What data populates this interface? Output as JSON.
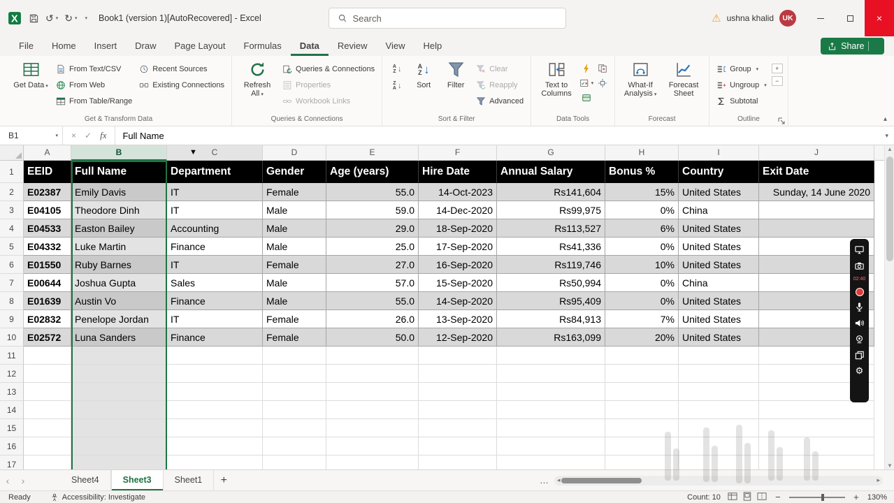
{
  "colors": {
    "accent_green": "#217346",
    "excel_logo_green": "#107c41",
    "header_fill": "#000000",
    "band_gray": "#d9d9d9",
    "close_red": "#e81123",
    "record_red": "#e03a3a",
    "avatar_red": "#bb3a42",
    "warning_yellow": "#e8a33d"
  },
  "title_bar": {
    "title": "Book1 (version 1)[AutoRecovered] -  Excel",
    "search_placeholder": "Search",
    "user_name": "ushna khalid",
    "user_initials": "UK"
  },
  "ribbon_tabs": [
    "File",
    "Home",
    "Insert",
    "Draw",
    "Page Layout",
    "Formulas",
    "Data",
    "Review",
    "View",
    "Help"
  ],
  "active_tab": "Data",
  "share_label": "Share",
  "ribbon": {
    "get_transform": {
      "label": "Get & Transform Data",
      "get_data": "Get Data",
      "from_text_csv": "From Text/CSV",
      "from_web": "From Web",
      "from_table_range": "From Table/Range",
      "recent_sources": "Recent Sources",
      "existing_connections": "Existing Connections"
    },
    "queries": {
      "label": "Queries & Connections",
      "refresh_all": "Refresh All",
      "queries_connections": "Queries & Connections",
      "properties": "Properties",
      "workbook_links": "Workbook Links"
    },
    "sort_filter": {
      "label": "Sort & Filter",
      "sort": "Sort",
      "filter": "Filter",
      "clear": "Clear",
      "reapply": "Reapply",
      "advanced": "Advanced"
    },
    "data_tools": {
      "label": "Data Tools",
      "text_to_columns": "Text to Columns"
    },
    "forecast": {
      "label": "Forecast",
      "what_if": "What-If Analysis",
      "forecast_sheet": "Forecast Sheet"
    },
    "outline": {
      "label": "Outline",
      "group": "Group",
      "ungroup": "Ungroup",
      "subtotal": "Subtotal"
    }
  },
  "formula_bar": {
    "name_box": "B1",
    "value": "Full Name"
  },
  "grid": {
    "columns": [
      "A",
      "B",
      "C",
      "D",
      "E",
      "F",
      "G",
      "H",
      "I",
      "J"
    ],
    "selected_column": "B",
    "cursor_column": "C",
    "visible_rows": 17,
    "headers": [
      "EEID",
      "Full Name",
      "Department",
      "Gender",
      "Age (years)",
      "Hire Date",
      "Annual Salary",
      "Bonus %",
      "Country",
      "Exit Date"
    ],
    "data": [
      [
        "E02387",
        "Emily Davis",
        "IT",
        "Female",
        "55.0",
        "14-Oct-2023",
        "Rs141,604",
        "15%",
        "United States",
        "Sunday, 14 June 2020"
      ],
      [
        "E04105",
        "Theodore Dinh",
        "IT",
        "Male",
        "59.0",
        "14-Dec-2020",
        "Rs99,975",
        "0%",
        "China",
        ""
      ],
      [
        "E04533",
        "Easton Bailey",
        "Accounting",
        "Male",
        "29.0",
        "18-Sep-2020",
        "Rs113,527",
        "6%",
        "United States",
        ""
      ],
      [
        "E04332",
        "Luke Martin",
        "Finance",
        "Male",
        "25.0",
        "17-Sep-2020",
        "Rs41,336",
        "0%",
        "United States",
        ""
      ],
      [
        "E01550",
        "Ruby Barnes",
        "IT",
        "Female",
        "27.0",
        "16-Sep-2020",
        "Rs119,746",
        "10%",
        "United States",
        ""
      ],
      [
        "E00644",
        "Joshua Gupta",
        "Sales",
        "Male",
        "57.0",
        "15-Sep-2020",
        "Rs50,994",
        "0%",
        "China",
        ""
      ],
      [
        "E01639",
        "Austin Vo",
        "Finance",
        "Male",
        "55.0",
        "14-Sep-2020",
        "Rs95,409",
        "0%",
        "United States",
        ""
      ],
      [
        "E02832",
        "Penelope Jordan",
        "IT",
        "Female",
        "26.0",
        "13-Sep-2020",
        "Rs84,913",
        "7%",
        "United States",
        ""
      ],
      [
        "E02572",
        "Luna Sanders",
        "Finance",
        "Female",
        "50.0",
        "12-Sep-2020",
        "Rs163,099",
        "20%",
        "United States",
        ""
      ]
    ]
  },
  "sheet_tabs": {
    "tabs": [
      "Sheet4",
      "Sheet3",
      "Sheet1"
    ],
    "active": "Sheet3"
  },
  "status_bar": {
    "mode": "Ready",
    "accessibility": "Accessibility: Investigate",
    "count": "Count: 10",
    "zoom_level": "130%"
  },
  "recorder": {
    "time": "02:40"
  }
}
